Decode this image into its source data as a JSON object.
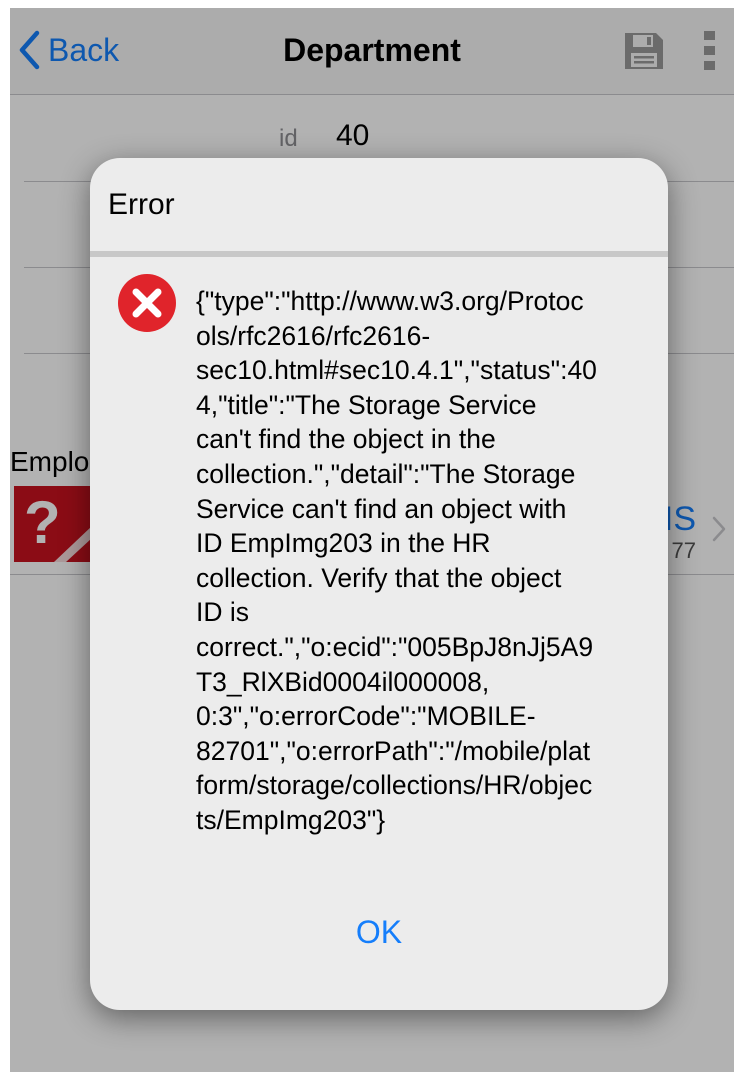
{
  "navbar": {
    "back_label": "Back",
    "title": "Department",
    "save_icon": "save-icon",
    "more_icon": "more-vertical-icon"
  },
  "form": {
    "id_label": "id",
    "id_value": "40"
  },
  "employees": {
    "section_label": "Emplo",
    "row": {
      "thumb_text": "?",
      "name_fragment": "IS",
      "sub_fragment": "77"
    }
  },
  "dialog": {
    "title": "Error",
    "icon": "error-x-icon",
    "message": "{\"type\":\"http://www.w3.org/Protoc\nols/rfc2616/rfc2616-\nsec10.html#sec10.4.1\",\"status\":40\n4,\"title\":\"The Storage Service\ncan't find the object in the\ncollection.\",\"detail\":\"The Storage\nService can't find an object with\nID EmpImg203 in the HR\ncollection. Verify that the object\nID is\ncorrect.\",\"o:ecid\":\"005BpJ8nJj5A9\nT3_RlXBid0004il000008,\n0:3\",\"o:errorCode\":\"MOBILE-\n82701\",\"o:errorPath\":\"/mobile/plat\nform/storage/collections/HR/objec\nts/EmpImg203\"}",
    "ok_label": "OK"
  },
  "colors": {
    "accent": "#157efb",
    "error_red": "#e0242b",
    "overlay": "rgba(0,0,0,0.30)"
  }
}
